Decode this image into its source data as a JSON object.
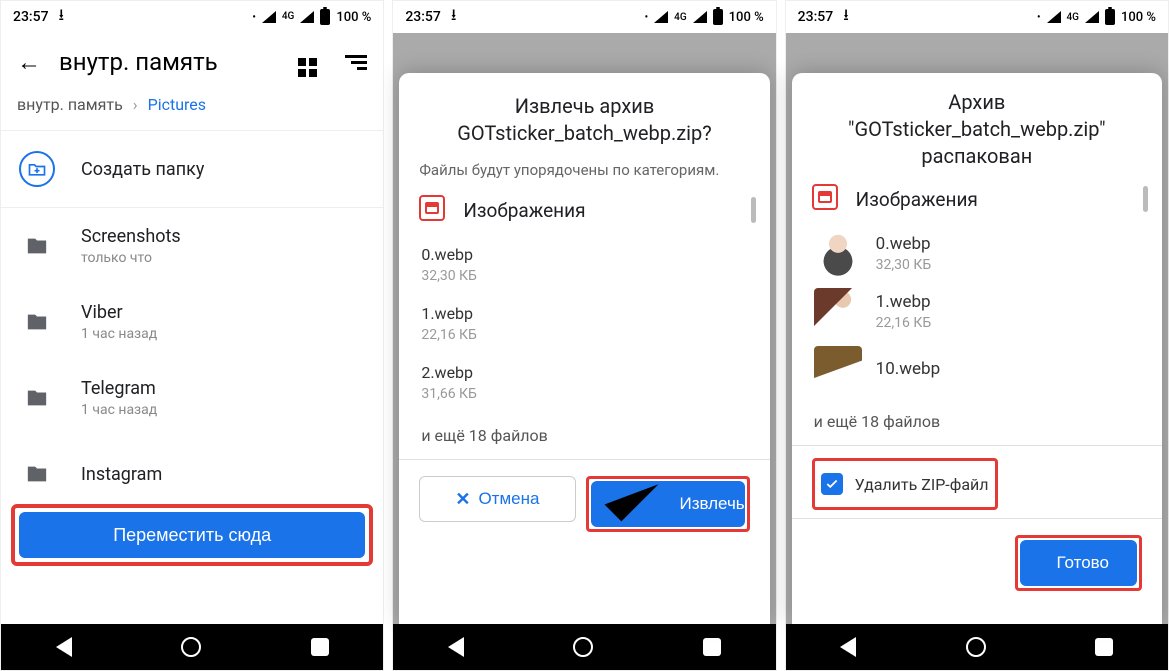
{
  "status": {
    "time": "23:57",
    "net_label": "4G",
    "battery": "100 %"
  },
  "screen1": {
    "title": "внутр. память",
    "breadcrumb_root": "внутр. память",
    "breadcrumb_current": "Pictures",
    "create_folder": "Создать папку",
    "folders": [
      {
        "name": "Screenshots",
        "sub": "только что"
      },
      {
        "name": "Viber",
        "sub": "1 час назад"
      },
      {
        "name": "Telegram",
        "sub": "1 час назад"
      },
      {
        "name": "Instagram",
        "sub": ""
      }
    ],
    "move_button": "Переместить сюда"
  },
  "screen2": {
    "title_line1": "Извлечь архив",
    "title_line2": "GOTsticker_batch_webp.zip?",
    "subtitle": "Файлы будут упорядочены по категориям.",
    "category": "Изображения",
    "files": [
      {
        "name": "0.webp",
        "size": "32,30 КБ"
      },
      {
        "name": "1.webp",
        "size": "22,16 КБ"
      },
      {
        "name": "2.webp",
        "size": "31,66 КБ"
      }
    ],
    "more": "и ещё 18 файлов",
    "cancel": "Отмена",
    "extract": "Извлечь"
  },
  "screen3": {
    "title_line1": "Архив",
    "title_line2": "\"GOTsticker_batch_webp.zip\"",
    "title_line3": "распакован",
    "category": "Изображения",
    "files": [
      {
        "name": "0.webp",
        "size": "32,30 КБ"
      },
      {
        "name": "1.webp",
        "size": "22,16 КБ"
      },
      {
        "name": "10.webp",
        "size": ""
      }
    ],
    "more": "и ещё 18 файлов",
    "delete_zip": "Удалить ZIP-файл",
    "done": "Готово"
  }
}
